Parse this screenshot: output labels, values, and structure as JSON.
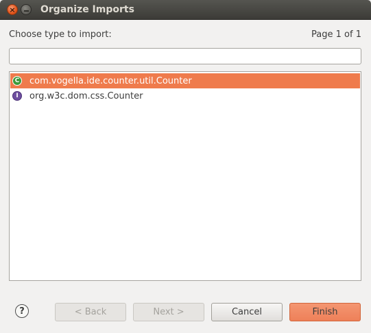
{
  "window": {
    "title": "Organize Imports",
    "close_glyph": "×"
  },
  "dialog": {
    "prompt": "Choose type to import:",
    "page_info": "Page 1 of 1",
    "filter_value": ""
  },
  "list": {
    "items": [
      {
        "label": "com.vogella.ide.counter.util.Counter",
        "icon": "class-icon",
        "icon_letter": "C",
        "selected": true
      },
      {
        "label": "org.w3c.dom.css.Counter",
        "icon": "interface-icon",
        "icon_letter": "I",
        "selected": false
      }
    ]
  },
  "buttons": {
    "help": "?",
    "back": "< Back",
    "next": "Next >",
    "cancel": "Cancel",
    "finish": "Finish"
  },
  "colors": {
    "selection": "#ef7b4c",
    "default_button": "#f08a64",
    "titlebar": "#3c3b37"
  }
}
